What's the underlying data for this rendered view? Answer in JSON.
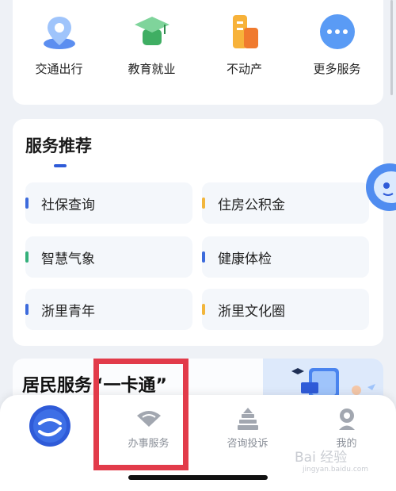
{
  "quick_services": [
    {
      "label": "交通出行",
      "icon": "map-pin-icon"
    },
    {
      "label": "教育就业",
      "icon": "graduation-cap-icon"
    },
    {
      "label": "不动产",
      "icon": "building-icon"
    },
    {
      "label": "更多服务",
      "icon": "more-dots-icon"
    }
  ],
  "recommend": {
    "title": "服务推荐",
    "items": [
      {
        "label": "社保查询",
        "color": "#3d6bdc"
      },
      {
        "label": "住房公积金",
        "color": "#f2b63c"
      },
      {
        "label": "智慧气象",
        "color": "#34b07a"
      },
      {
        "label": "健康体检",
        "color": "#3d6bdc"
      },
      {
        "label": "浙里青年",
        "color": "#3d6bdc"
      },
      {
        "label": "浙里文化圈",
        "color": "#f2b63c"
      }
    ]
  },
  "resident": {
    "title": "居民服务“一卡通”"
  },
  "tabbar": {
    "items": [
      {
        "label": "",
        "icon": "app-logo-icon"
      },
      {
        "label": "办事服务",
        "icon": "fan-icon"
      },
      {
        "label": "咨询投诉",
        "icon": "pagoda-icon"
      },
      {
        "label": "我的",
        "icon": "profile-icon"
      }
    ]
  },
  "watermark": {
    "text": "Bai 经验",
    "sub": "jingyan.baidu.com"
  },
  "colors": {
    "accent": "#2f5bd8",
    "highlight": "#e23b4a"
  }
}
